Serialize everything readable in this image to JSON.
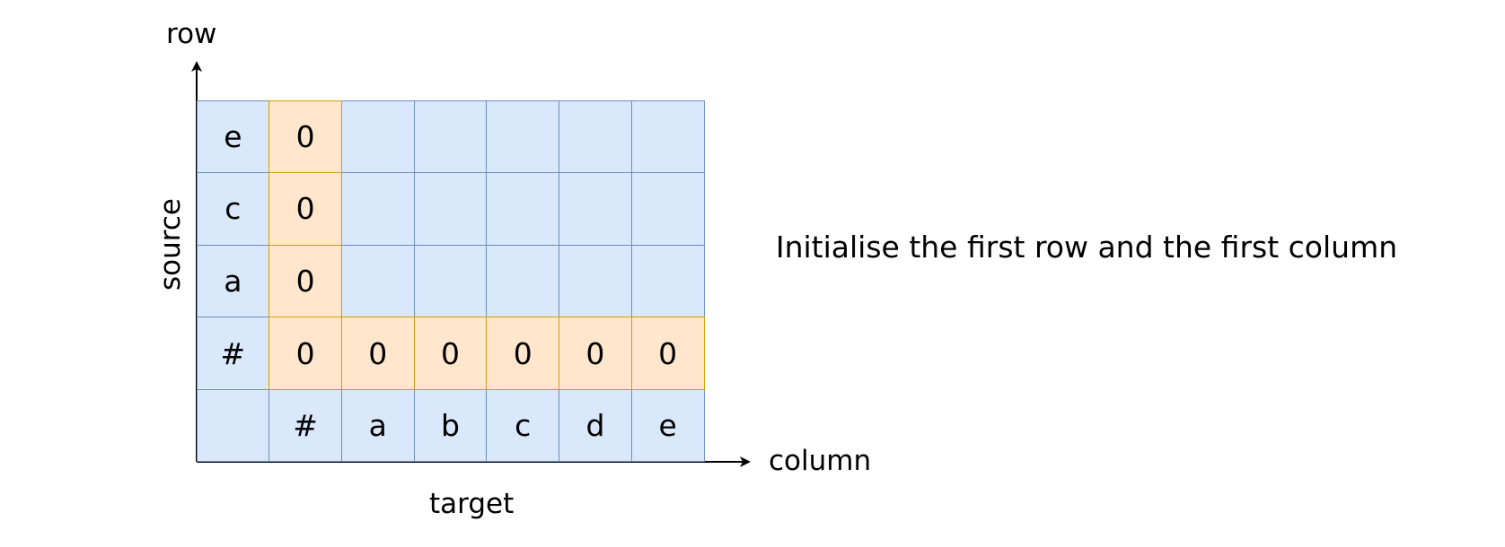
{
  "axes": {
    "vertical_label": "row",
    "horizontal_label": "column",
    "source_label": "source",
    "target_label": "target"
  },
  "grid": {
    "rows": [
      [
        "e",
        "0",
        "",
        "",
        "",
        "",
        ""
      ],
      [
        "c",
        "0",
        "",
        "",
        "",
        "",
        ""
      ],
      [
        "a",
        "0",
        "",
        "",
        "",
        "",
        ""
      ],
      [
        "#",
        "0",
        "0",
        "0",
        "0",
        "0",
        "0"
      ],
      [
        "",
        "#",
        "a",
        "b",
        "c",
        "d",
        "e"
      ]
    ],
    "initialized_cells": [
      [
        0,
        1
      ],
      [
        1,
        1
      ],
      [
        2,
        1
      ],
      [
        3,
        1
      ],
      [
        3,
        2
      ],
      [
        3,
        3
      ],
      [
        3,
        4
      ],
      [
        3,
        5
      ],
      [
        3,
        6
      ]
    ]
  },
  "caption": "Initialise the first row and the first column",
  "colors": {
    "cell_fill": "#dae8fc",
    "cell_border": "#6c8ebf",
    "init_fill": "#ffe6cc",
    "init_border": "#d79b00",
    "axis": "#000000"
  }
}
